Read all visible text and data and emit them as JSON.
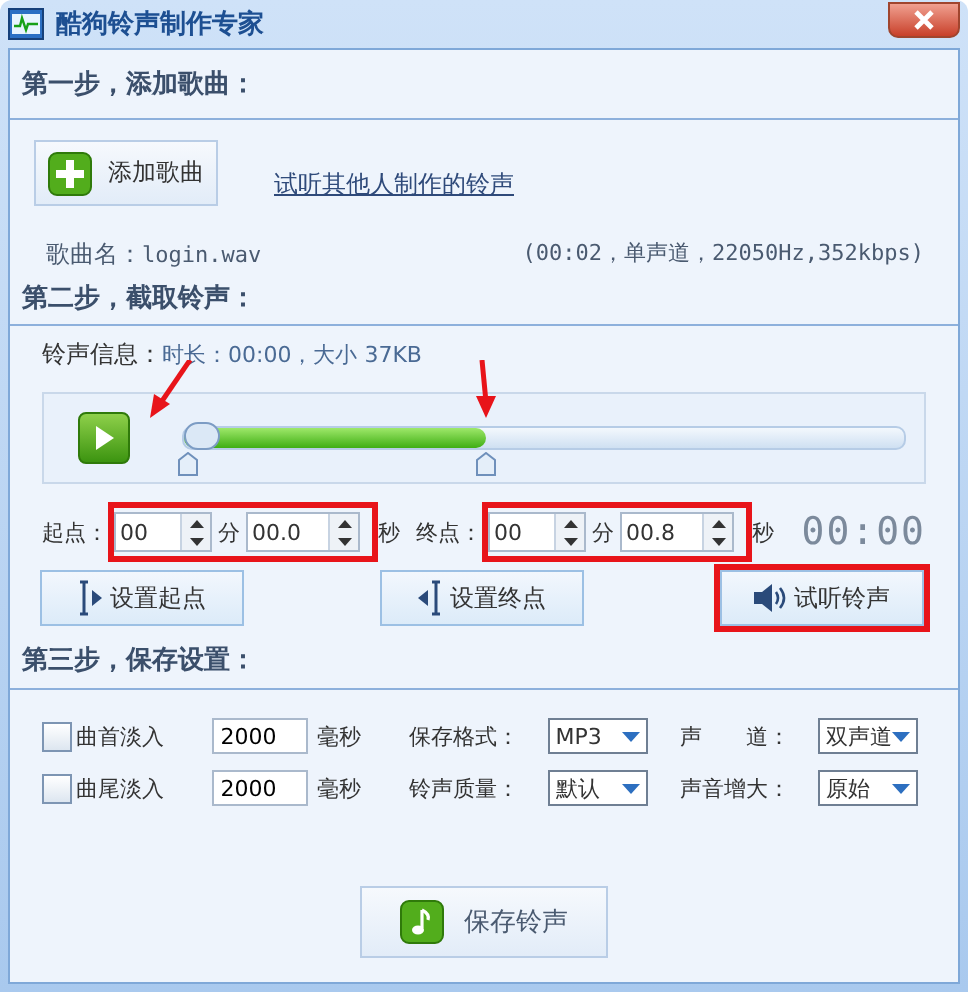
{
  "window": {
    "title": "酷狗铃声制作专家"
  },
  "step1": {
    "heading": "第一步，添加歌曲：",
    "add_button": "添加歌曲",
    "link": "试听其他人制作的铃声",
    "song_label": "歌曲名：",
    "song_name": "login.wav",
    "song_info": "(00:02，单声道，22050Hz,352kbps)"
  },
  "step2": {
    "heading": "第二步，截取铃声：",
    "info_label": "铃声信息：",
    "info_value": "时长：00:00，大小 37KB",
    "slider": {
      "start": {
        "level": 0,
        "arrow": true
      },
      "end": {
        "level": 0.42,
        "arrow": true
      }
    },
    "points": [
      {
        "label": "起点：",
        "minutes": "00",
        "minutes_unit": "分",
        "seconds": "00.0",
        "seconds_unit": "秒",
        "highlighted": true
      },
      {
        "label": "终点：",
        "minutes": "00",
        "minutes_unit": "分",
        "seconds": "00.8",
        "seconds_unit": "秒",
        "highlighted": true
      }
    ],
    "time_display": "00:00",
    "buttons": [
      {
        "kind": "set-start",
        "label": "设置起点",
        "highlighted": false
      },
      {
        "kind": "set-end",
        "label": "设置终点",
        "highlighted": false
      },
      {
        "kind": "preview",
        "label": "试听铃声",
        "highlighted": true
      }
    ]
  },
  "step3": {
    "heading": "第三步，保存设置：",
    "rows": [
      {
        "label": "曲首淡入",
        "checked": false,
        "value": "2000",
        "unit": "毫秒",
        "settings": [
          {
            "label": "保存格式：",
            "value": "MP3"
          },
          {
            "label": "声　　道：",
            "value": "双声道"
          }
        ]
      },
      {
        "label": "曲尾淡入",
        "checked": false,
        "value": "2000",
        "unit": "毫秒",
        "settings": [
          {
            "label": "铃声质量：",
            "value": "默认"
          },
          {
            "label": "声音增大：",
            "value": "原始"
          }
        ]
      }
    ],
    "save_button": "保存铃声"
  }
}
